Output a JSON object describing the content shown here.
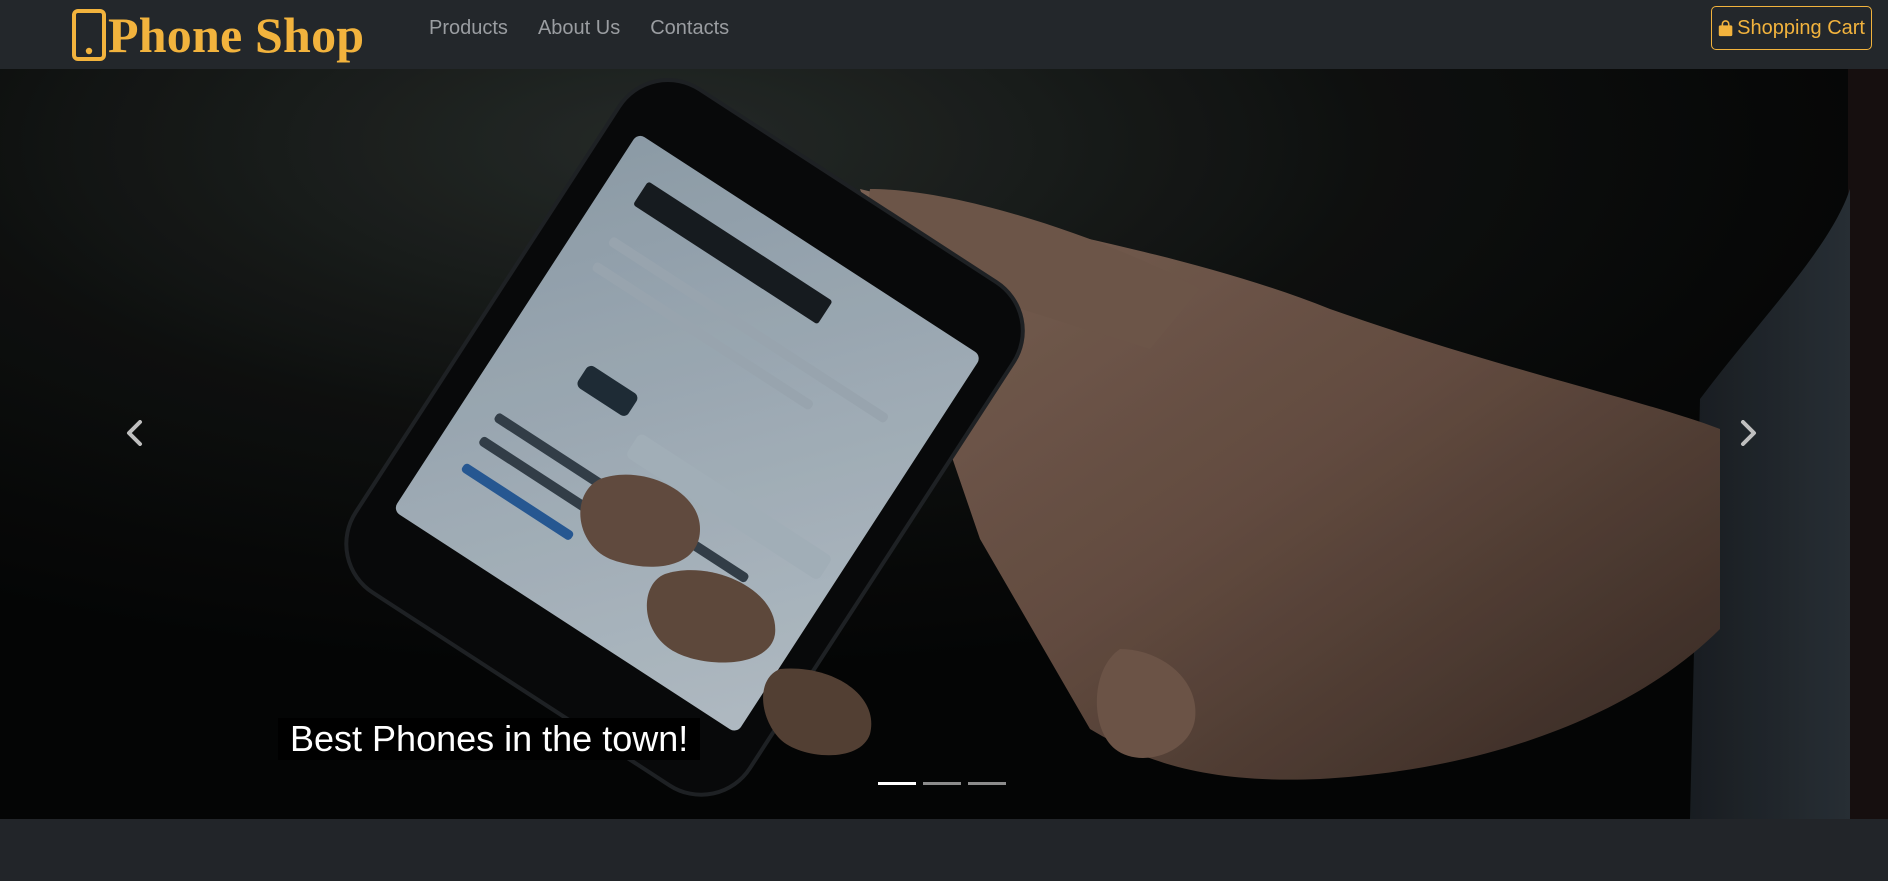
{
  "colors": {
    "brand": "#f2b33d",
    "navbar_bg": "#23272b",
    "page_bg": "#222529",
    "nav_link": "#9a9da1"
  },
  "brand": {
    "icon": "phone-icon",
    "name": "Phone Shop"
  },
  "nav": {
    "links": [
      {
        "label": "Products"
      },
      {
        "label": "About Us"
      },
      {
        "label": "Contacts"
      }
    ]
  },
  "cart": {
    "icon": "shopping-bag-icon",
    "label": "Shopping Cart"
  },
  "carousel": {
    "prev_icon": "chevron-left-icon",
    "next_icon": "chevron-right-icon",
    "caption": "Best Phones in the town!",
    "slide_count": 3,
    "active_slide": 1
  }
}
